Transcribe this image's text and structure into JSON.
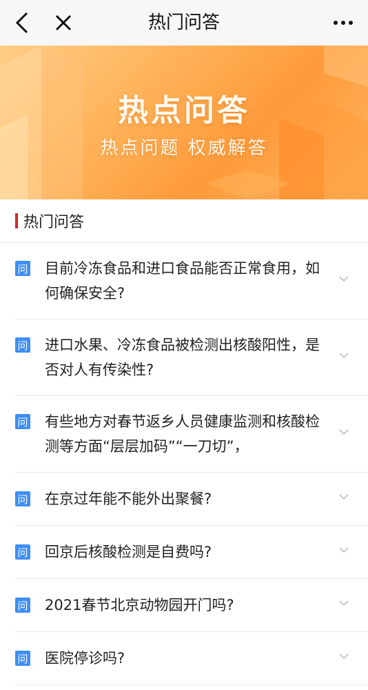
{
  "navbar": {
    "title": "热门问答",
    "back_icon": "chevron-left-icon",
    "close_icon": "close-icon",
    "more_icon": "more-horizontal-icon"
  },
  "banner": {
    "title": "热点问答",
    "subtitle": "热点问题 权威解答",
    "colors": {
      "start": "#ffcd86",
      "mid": "#fe9a3b",
      "end": "#ffb765"
    }
  },
  "section": {
    "title": "热门问答",
    "accent_color": "#d9272a"
  },
  "questions": {
    "badge": "问",
    "badge_color": "#3e8ef5",
    "items": [
      {
        "text": "目前冷冻食品和进口食品能否正常食用，如何确保安全?"
      },
      {
        "text": "进口水果、冷冻食品被检测出核酸阳性，是否对人有传染性?"
      },
      {
        "text": "有些地方对春节返乡人员健康监测和核酸检测等方面“层层加码”“一刀切”，"
      },
      {
        "text": "在京过年能不能外出聚餐?"
      },
      {
        "text": "回京后核酸检测是自费吗?"
      },
      {
        "text": "2021春节北京动物园开门吗?"
      },
      {
        "text": "医院停诊吗?"
      }
    ]
  }
}
